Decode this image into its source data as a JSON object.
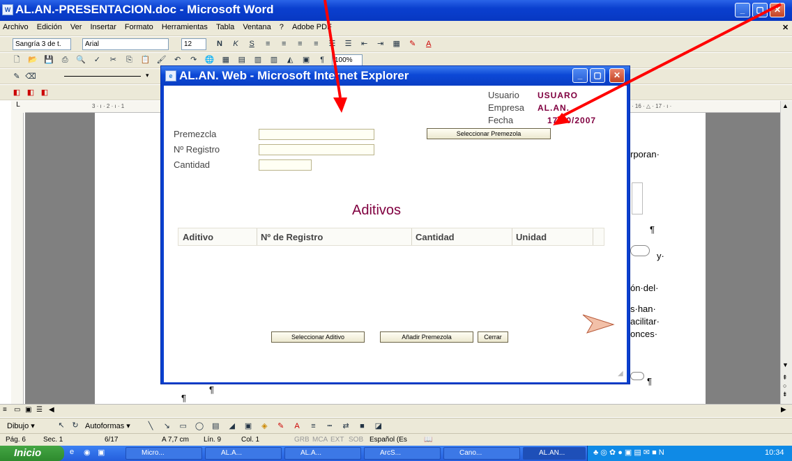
{
  "word": {
    "title": "AL.AN.-PRESENTACION.doc - Microsoft Word",
    "menu": [
      "Archivo",
      "Edición",
      "Ver",
      "Insertar",
      "Formato",
      "Herramientas",
      "Tabla",
      "Ventana",
      "?",
      "Adobe PDF"
    ],
    "style_combo": "Sangría 3 de t.",
    "font_combo": "Arial",
    "size_combo": "12",
    "zoom": "100%",
    "ruler_text": "3 · ı · 2 · ı · 1",
    "ruler_right": "· 16 · △ · 17 · ı ·",
    "doc_fragments": [
      "rporan·",
      "¶",
      "y·",
      "ón·del·",
      "s·han·",
      "acilitar·",
      "onces·",
      "¶",
      "¶",
      "¶"
    ]
  },
  "dialog": {
    "title": "AL.AN. Web - Microsoft Internet Explorer",
    "usuario_label": "Usuario",
    "usuario_value": "USUARO",
    "empresa_label": "Empresa",
    "empresa_value": "AL.AN.",
    "fecha_label": "Fecha",
    "fecha_value": "17/10/2007",
    "premezcla_label": "Premezcla",
    "registro_label": "Nº Registro",
    "cantidad_label": "Cantidad",
    "seleccionar_premezcla": "Seleccionar Premezola",
    "section_title": "Aditivos",
    "columns": [
      "Aditivo",
      "Nº de Registro",
      "Cantidad",
      "Unidad"
    ],
    "seleccionar_aditivo": "Seleccionar Aditivo",
    "anadir_premezcla": "Añadir Premezola",
    "cerrar": "Cerrar"
  },
  "drawing": {
    "dibujo": "Dibujo ▾",
    "autoformas": "Autoformas ▾"
  },
  "status": {
    "pag": "Pág. 6",
    "sec": "Sec. 1",
    "pages": "6/17",
    "pos": "A 7,7 cm",
    "lin": "Lín. 9",
    "col": "Col. 1",
    "grb": "GRB",
    "mca": "MCA",
    "ext": "EXT",
    "sob": "SOB",
    "lang": "Español (Es"
  },
  "taskbar": {
    "start": "Inicio",
    "tasks": [
      "Micro...",
      "AL.A...",
      "AL.A...",
      "ArcS...",
      "Cano...",
      "AL.AN..."
    ],
    "clock": "10:34"
  },
  "colors": {
    "accent": "#800040",
    "arrow": "#ff0000",
    "title_blue": "#0a3fcf"
  }
}
